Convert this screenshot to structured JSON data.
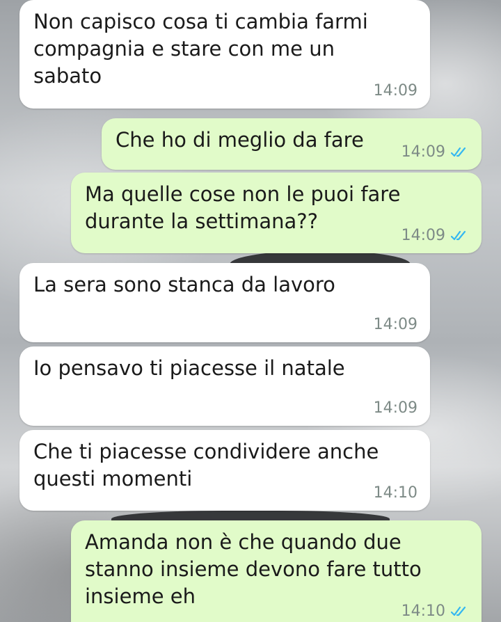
{
  "chat": {
    "messages": [
      {
        "direction": "in",
        "text": "Non capisco cosa ti cambia farmi\ncompagnia e stare con me un\nsabato",
        "time": "14:09"
      },
      {
        "direction": "out",
        "text": "Che ho di meglio da fare",
        "time": "14:09",
        "status": "read"
      },
      {
        "direction": "out",
        "text": "Ma quelle cose non le puoi fare\ndurante la settimana??",
        "time": "14:09",
        "status": "read"
      },
      {
        "direction": "in",
        "text": "La sera sono stanca da lavoro",
        "time": "14:09"
      },
      {
        "direction": "in",
        "text": "Io pensavo ti piacesse il natale",
        "time": "14:09"
      },
      {
        "direction": "in",
        "text": "Che ti piacesse condividere anche\nquesti momenti",
        "time": "14:10"
      },
      {
        "direction": "out",
        "text": "Amanda non è che quando due\nstanno insieme devono fare tutto\ninsieme eh",
        "time": "14:10",
        "status": "read"
      }
    ]
  },
  "colors": {
    "incoming_bubble": "#ffffff",
    "outgoing_bubble": "#e1fbc9",
    "read_ticks": "#34b7f1",
    "timestamp": "#7d8a86"
  },
  "icons": {
    "read_receipt": "double-check-icon"
  }
}
